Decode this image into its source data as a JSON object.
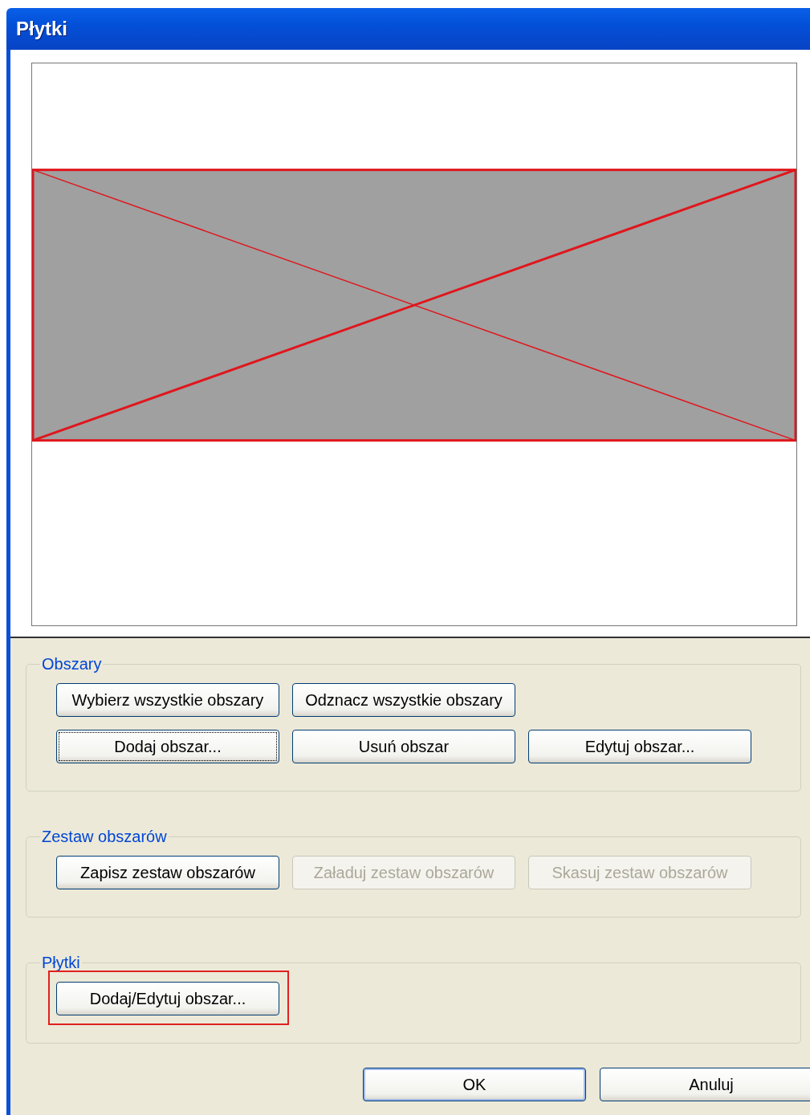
{
  "window": {
    "title": "Płytki"
  },
  "groups": [
    {
      "title": "Obszary",
      "rows": [
        [
          {
            "label": "Wybierz wszystkie obszary",
            "disabled": false,
            "focused": false,
            "highlighted": false
          },
          {
            "label": "Odznacz wszystkie obszary",
            "disabled": false,
            "focused": false,
            "highlighted": false
          }
        ],
        [
          {
            "label": "Dodaj obszar...",
            "disabled": false,
            "focused": true,
            "highlighted": false
          },
          {
            "label": "Usuń obszar",
            "disabled": false,
            "focused": false,
            "highlighted": false
          },
          {
            "label": "Edytuj obszar...",
            "disabled": false,
            "focused": false,
            "highlighted": false
          }
        ]
      ]
    },
    {
      "title": "Zestaw obszarów",
      "rows": [
        [
          {
            "label": "Zapisz zestaw obszarów",
            "disabled": false,
            "focused": false,
            "highlighted": false
          },
          {
            "label": "Załaduj zestaw obszarów",
            "disabled": true,
            "focused": false,
            "highlighted": false
          },
          {
            "label": "Skasuj zestaw obszarów",
            "disabled": true,
            "focused": false,
            "highlighted": false
          }
        ]
      ]
    },
    {
      "title": "Płytki",
      "rows": [
        [
          {
            "label": "Dodaj/Edytuj obszar...",
            "disabled": false,
            "focused": false,
            "highlighted": true
          }
        ]
      ]
    }
  ],
  "buttons": [
    {
      "label": "OK",
      "default": true
    },
    {
      "label": "Anuluj",
      "default": false
    }
  ]
}
